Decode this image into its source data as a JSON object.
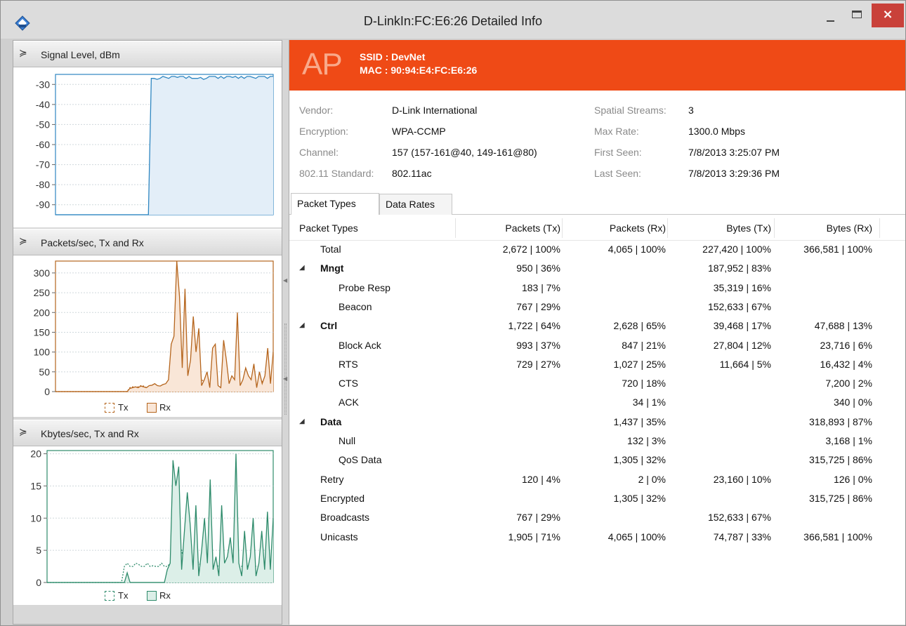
{
  "window": {
    "title": "D-LinkIn:FC:E6:26 Detailed Info",
    "minimize_glyph": "–",
    "close_glyph": "×",
    "icon": "router-icon"
  },
  "left_pane": {
    "charts": [
      {
        "title": "Signal Level, dBm",
        "chart_data": {
          "type": "line",
          "ylabel": "",
          "y_ticks": [
            "-30",
            "-40",
            "-50",
            "-60",
            "-70",
            "-80",
            "-90"
          ],
          "ylim": [
            -95,
            -25
          ],
          "series": [
            {
              "values": [
                -95,
                -95,
                -95,
                -95,
                -95,
                -95,
                -95,
                -95,
                -95,
                -95,
                -95,
                -95,
                -95,
                -95,
                -95,
                -95,
                -95,
                -95,
                -95,
                -95,
                -95,
                -95,
                -95,
                -95,
                -95,
                -95,
                -95,
                -95,
                -95,
                -95,
                -95,
                -95,
                -95,
                -27,
                -27,
                -27.5,
                -27,
                -26,
                -26.5,
                -27,
                -26,
                -26,
                -26.5,
                -26,
                -26,
                -27,
                -26,
                -27,
                -27,
                -27,
                -26.5,
                -27.5,
                -27,
                -26,
                -26,
                -26,
                -27,
                -26,
                -27,
                -26,
                -26,
                -26.5,
                -26,
                -27,
                -26,
                -27,
                -26,
                -26,
                -26.5,
                -27,
                -26,
                -26,
                -26,
                -27,
                -26,
                -26
              ]
            }
          ],
          "grid": true,
          "color": "#2e86c1",
          "fill": "#e3eef8"
        }
      },
      {
        "title": "Packets/sec, Tx and Rx",
        "chart_data": {
          "type": "area",
          "y_ticks": [
            "300",
            "250",
            "200",
            "150",
            "100",
            "50",
            "0"
          ],
          "ylim": [
            0,
            330
          ],
          "series": [
            {
              "name": "Tx",
              "values": [
                0,
                0,
                0,
                0,
                0,
                0,
                0,
                0,
                0,
                0,
                0,
                0,
                0,
                0,
                0,
                0,
                0,
                0,
                0,
                0,
                0,
                0,
                0,
                0,
                0,
                0,
                0,
                10,
                12,
                10,
                12,
                15,
                14,
                10,
                12,
                18,
                16,
                14,
                14,
                15,
                18,
                20,
                60,
                20,
                60,
                80,
                40,
                70,
                20,
                60,
                65,
                30,
                60,
                30,
                25,
                40,
                10,
                10,
                12,
                10,
                10,
                10,
                10,
                10,
                10,
                10,
                15,
                10,
                10,
                20,
                10,
                30,
                20,
                10,
                10,
                25,
                10,
                10,
                10,
                15
              ]
            },
            {
              "name": "Rx",
              "values": [
                0,
                0,
                0,
                0,
                0,
                0,
                0,
                0,
                0,
                0,
                0,
                0,
                0,
                0,
                0,
                0,
                0,
                0,
                0,
                0,
                0,
                0,
                0,
                0,
                0,
                0,
                0,
                8,
                10,
                12,
                10,
                14,
                12,
                10,
                15,
                16,
                20,
                15,
                14,
                18,
                20,
                30,
                120,
                140,
                340,
                240,
                60,
                260,
                40,
                80,
                190,
                100,
                160,
                15,
                30,
                50,
                10,
                110,
                120,
                15,
                10,
                130,
                80,
                20,
                40,
                30,
                200,
                15,
                30,
                60,
                40,
                30,
                70,
                10,
                50,
                20,
                40,
                110,
                20,
                100
              ]
            }
          ],
          "legend": "bottom",
          "grid": true,
          "color": "#b5651d",
          "fill": "#f9e6d7"
        }
      },
      {
        "title": "Kbytes/sec, Tx and Rx",
        "chart_data": {
          "type": "area",
          "y_ticks": [
            "20",
            "15",
            "10",
            "5",
            "0"
          ],
          "ylim": [
            0,
            20.5
          ],
          "series": [
            {
              "name": "Tx",
              "values": [
                0,
                0,
                0,
                0,
                0,
                0,
                0,
                0,
                0,
                0,
                0,
                0,
                0,
                0,
                0,
                0,
                0,
                0,
                0,
                0,
                0,
                0,
                0,
                0,
                0,
                0,
                0,
                2.5,
                3,
                2.5,
                2.5,
                3,
                2.8,
                2.5,
                2.5,
                3,
                2.5,
                2.6,
                2.5,
                2.5,
                3,
                2.5,
                2.5,
                3,
                4,
                3,
                4.5,
                5,
                3,
                4,
                3.5,
                2.5,
                4,
                3,
                2.5,
                3,
                2.5,
                2.3,
                2.5,
                3,
                2.3,
                2.5,
                2.3,
                3,
                2.5,
                2.3,
                3,
                2.5,
                2.5,
                3,
                2.6,
                2.4,
                3,
                2.5,
                2.5,
                3,
                2.5,
                2.5,
                2.4,
                3
              ]
            },
            {
              "name": "Rx",
              "values": [
                0,
                0,
                0,
                0,
                0,
                0,
                0,
                0,
                0,
                0,
                0,
                0,
                0,
                0,
                0,
                0,
                0,
                0,
                0,
                0,
                0,
                0,
                0,
                0,
                0,
                0,
                0,
                0,
                1.5,
                0,
                0,
                0,
                0,
                0,
                0,
                0,
                0,
                0,
                0,
                0,
                0,
                0,
                2,
                3,
                19,
                15,
                18,
                2,
                8,
                14,
                9,
                2,
                12,
                1,
                5,
                10,
                3,
                16,
                2,
                4,
                1,
                12,
                3,
                4,
                7,
                3,
                20,
                3,
                1,
                8,
                2,
                4,
                10,
                1,
                3,
                8,
                2,
                11,
                2,
                10
              ]
            }
          ],
          "legend": "bottom",
          "grid": true,
          "color": "#2e8b6b",
          "fill": "#dcefe8"
        }
      }
    ],
    "legend": {
      "tx": "Tx",
      "rx": "Rx"
    }
  },
  "ap": {
    "badge": "AP",
    "ssid_label": "SSID : DevNet",
    "mac_label": "MAC : 90:94:E4:FC:E6:26"
  },
  "info": {
    "vendor_label": "Vendor:",
    "vendor": "D-Link International",
    "encryption_label": "Encryption:",
    "encryption": "WPA-CCMP",
    "channel_label": "Channel:",
    "channel": "157 (157-161@40, 149-161@80)",
    "standard_label": "802.11 Standard:",
    "standard": "802.11ac",
    "streams_label": "Spatial Streams:",
    "streams": "3",
    "maxrate_label": "Max Rate:",
    "maxrate": "1300.0 Mbps",
    "firstseen_label": "First Seen:",
    "firstseen": "7/8/2013 3:25:07 PM",
    "lastseen_label": "Last Seen:",
    "lastseen": "7/8/2013 3:29:36 PM"
  },
  "tabs": [
    {
      "label": "Packet Types"
    },
    {
      "label": "Data Rates"
    }
  ],
  "table": {
    "columns": [
      "Packet Types",
      "Packets (Tx)",
      "Packets (Rx)",
      "Bytes (Tx)",
      "Bytes (Rx)"
    ],
    "rows": [
      {
        "name": "Total",
        "level": 0,
        "bold": false,
        "group": false,
        "ptx": "2,672 | 100%",
        "prx": "4,065 | 100%",
        "btx": "227,420 | 100%",
        "brx": "366,581 | 100%"
      },
      {
        "name": "Mngt",
        "level": 0,
        "bold": true,
        "group": true,
        "ptx": "950 | 36%",
        "prx": "",
        "btx": "187,952 | 83%",
        "brx": ""
      },
      {
        "name": "Probe Resp",
        "level": 1,
        "bold": false,
        "group": false,
        "ptx": "183 | 7%",
        "prx": "",
        "btx": "35,319 | 16%",
        "brx": ""
      },
      {
        "name": "Beacon",
        "level": 1,
        "bold": false,
        "group": false,
        "ptx": "767 | 29%",
        "prx": "",
        "btx": "152,633 | 67%",
        "brx": ""
      },
      {
        "name": "Ctrl",
        "level": 0,
        "bold": true,
        "group": true,
        "ptx": "1,722 | 64%",
        "prx": "2,628 | 65%",
        "btx": "39,468 | 17%",
        "brx": "47,688 | 13%"
      },
      {
        "name": "Block Ack",
        "level": 1,
        "bold": false,
        "group": false,
        "ptx": "993 | 37%",
        "prx": "847 | 21%",
        "btx": "27,804 | 12%",
        "brx": "23,716 | 6%"
      },
      {
        "name": "RTS",
        "level": 1,
        "bold": false,
        "group": false,
        "ptx": "729 | 27%",
        "prx": "1,027 | 25%",
        "btx": "11,664 | 5%",
        "brx": "16,432 | 4%"
      },
      {
        "name": "CTS",
        "level": 1,
        "bold": false,
        "group": false,
        "ptx": "",
        "prx": "720 | 18%",
        "btx": "",
        "brx": "7,200 | 2%"
      },
      {
        "name": "ACK",
        "level": 1,
        "bold": false,
        "group": false,
        "ptx": "",
        "prx": "34 | 1%",
        "btx": "",
        "brx": "340 | 0%"
      },
      {
        "name": "Data",
        "level": 0,
        "bold": true,
        "group": true,
        "ptx": "",
        "prx": "1,437 | 35%",
        "btx": "",
        "brx": "318,893 | 87%"
      },
      {
        "name": "Null",
        "level": 1,
        "bold": false,
        "group": false,
        "ptx": "",
        "prx": "132 | 3%",
        "btx": "",
        "brx": "3,168 | 1%"
      },
      {
        "name": "QoS Data",
        "level": 1,
        "bold": false,
        "group": false,
        "ptx": "",
        "prx": "1,305 | 32%",
        "btx": "",
        "brx": "315,725 | 86%"
      },
      {
        "name": "Retry",
        "level": 0,
        "bold": false,
        "group": false,
        "ptx": "120 | 4%",
        "prx": "2 | 0%",
        "btx": "23,160 | 10%",
        "brx": "126 | 0%"
      },
      {
        "name": "Encrypted",
        "level": 0,
        "bold": false,
        "group": false,
        "ptx": "",
        "prx": "1,305 | 32%",
        "btx": "",
        "brx": "315,725 | 86%"
      },
      {
        "name": "Broadcasts",
        "level": 0,
        "bold": false,
        "group": false,
        "ptx": "767 | 29%",
        "prx": "",
        "btx": "152,633 | 67%",
        "brx": ""
      },
      {
        "name": "Unicasts",
        "level": 0,
        "bold": false,
        "group": false,
        "ptx": "1,905 | 71%",
        "prx": "4,065 | 100%",
        "btx": "74,787 | 33%",
        "brx": "366,581 | 100%"
      }
    ]
  }
}
